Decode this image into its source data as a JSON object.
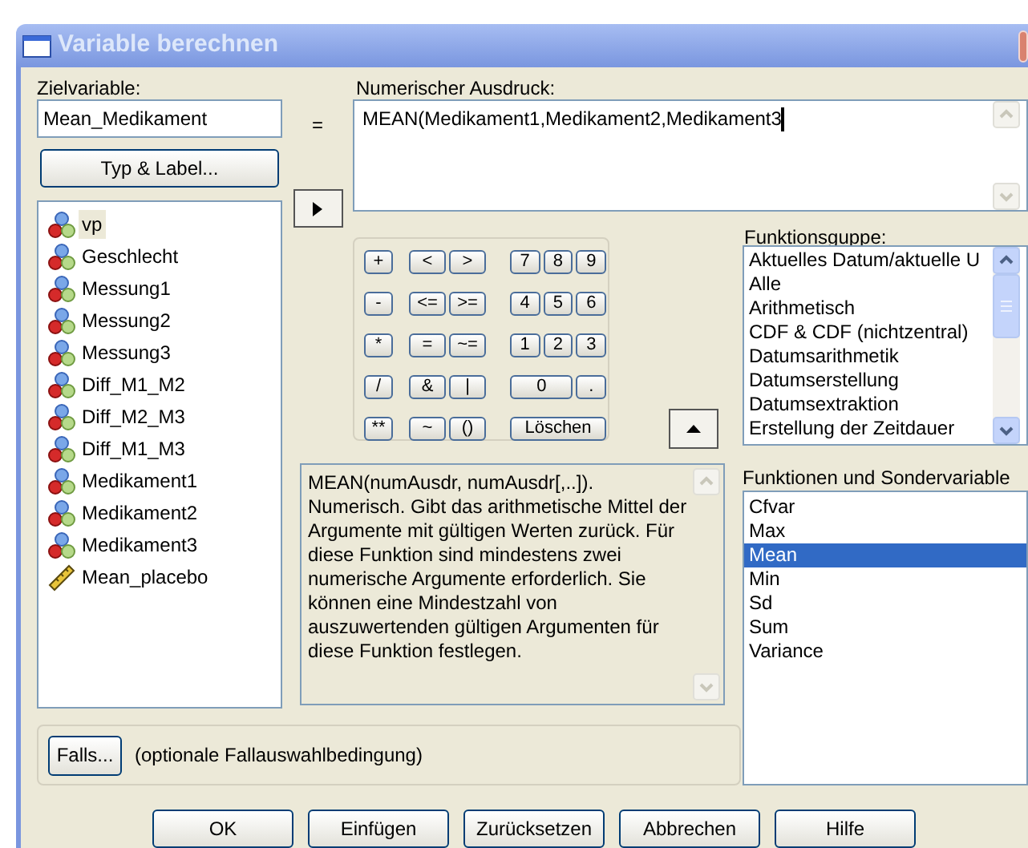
{
  "window": {
    "title": "Variable berechnen"
  },
  "target": {
    "label": "Zielvariable:",
    "value": "Mean_Medikament"
  },
  "equals": "=",
  "type_label_button": "Typ & Label...",
  "variables": [
    {
      "name": "vp",
      "kind": "nominal",
      "selected": true
    },
    {
      "name": "Geschlecht",
      "kind": "nominal",
      "selected": false
    },
    {
      "name": "Messung1",
      "kind": "nominal",
      "selected": false
    },
    {
      "name": "Messung2",
      "kind": "nominal",
      "selected": false
    },
    {
      "name": "Messung3",
      "kind": "nominal",
      "selected": false
    },
    {
      "name": "Diff_M1_M2",
      "kind": "nominal",
      "selected": false
    },
    {
      "name": "Diff_M2_M3",
      "kind": "nominal",
      "selected": false
    },
    {
      "name": "Diff_M1_M3",
      "kind": "nominal",
      "selected": false
    },
    {
      "name": "Medikament1",
      "kind": "nominal",
      "selected": false
    },
    {
      "name": "Medikament2",
      "kind": "nominal",
      "selected": false
    },
    {
      "name": "Medikament3",
      "kind": "nominal",
      "selected": false
    },
    {
      "name": "Mean_placebo",
      "kind": "scale",
      "selected": false
    }
  ],
  "expression": {
    "label": "Numerischer Ausdruck:",
    "value": "MEAN(Medikament1,Medikament2,Medikament3"
  },
  "calculator": {
    "rows": [
      [
        [
          "+"
        ],
        [
          "<",
          ">"
        ],
        [
          "7",
          "8",
          "9"
        ]
      ],
      [
        [
          "-"
        ],
        [
          "<=",
          ">="
        ],
        [
          "4",
          "5",
          "6"
        ]
      ],
      [
        [
          "*"
        ],
        [
          "=",
          "~="
        ],
        [
          "1",
          "2",
          "3"
        ]
      ],
      [
        [
          "/"
        ],
        [
          "&",
          "|"
        ],
        [
          "0",
          "."
        ]
      ],
      [
        [
          "**"
        ],
        [
          "~",
          "()"
        ],
        [
          "Löschen"
        ]
      ]
    ]
  },
  "function_groups": {
    "label": "Funktionsguppe:",
    "items": [
      "Aktuelles Datum/aktuelle U",
      "Alle",
      "Arithmetisch",
      "CDF & CDF (nichtzentral)",
      "Datumsarithmetik",
      "Datumserstellung",
      "Datumsextraktion",
      "Erstellung der Zeitdauer"
    ]
  },
  "description": "MEAN(numAusdr, numAusdr[,..]). Numerisch. Gibt das arithmetische Mittel der Argumente mit gültigen Werten zurück. Für diese Funktion sind mindestens zwei numerische Argumente erforderlich. Sie können eine Mindestzahl von auszuwertenden gültigen Argumenten für diese Funktion festlegen.",
  "functions": {
    "label": "Funktionen und Sondervariable",
    "items": [
      {
        "name": "Cfvar",
        "selected": false
      },
      {
        "name": "Max",
        "selected": false
      },
      {
        "name": "Mean",
        "selected": true
      },
      {
        "name": "Min",
        "selected": false
      },
      {
        "name": "Sd",
        "selected": false
      },
      {
        "name": "Sum",
        "selected": false
      },
      {
        "name": "Variance",
        "selected": false
      }
    ]
  },
  "condition": {
    "button": "Falls...",
    "text": "(optionale Fallauswahlbedingung)"
  },
  "buttons": [
    "OK",
    "Einfügen",
    "Zurücksetzen",
    "Abbrechen",
    "Hilfe"
  ]
}
